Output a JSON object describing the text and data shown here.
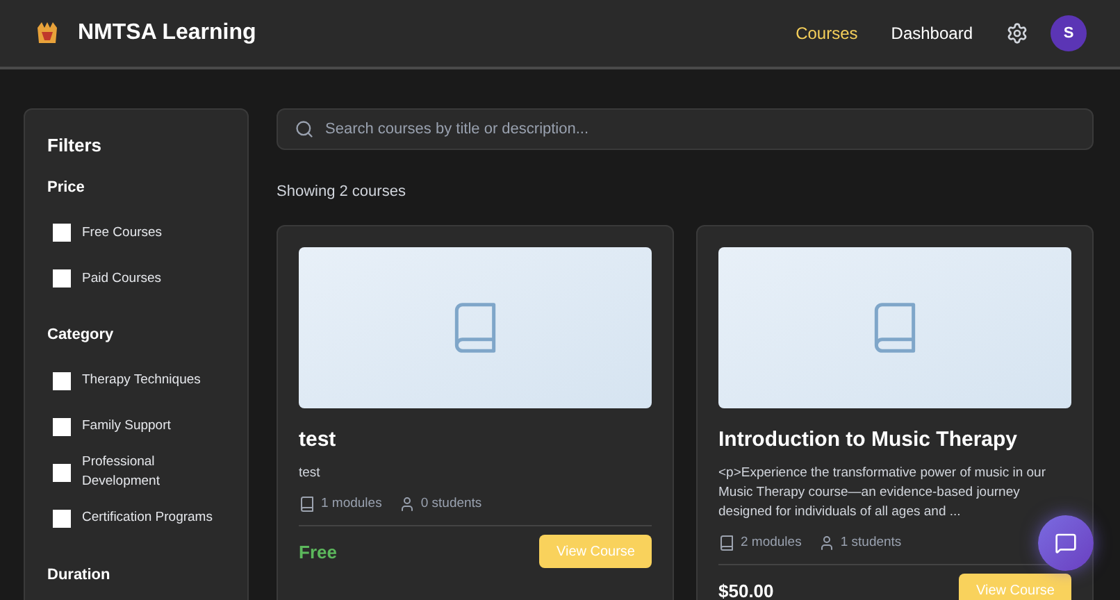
{
  "header": {
    "brand": "NMTSA Learning",
    "nav": [
      {
        "label": "Courses",
        "selected": true
      },
      {
        "label": "Dashboard",
        "selected": false
      }
    ],
    "avatar": "S"
  },
  "filters": {
    "title": "Filters",
    "groups": [
      {
        "title": "Price",
        "options": [
          {
            "label": "Free Courses",
            "checked": false
          },
          {
            "label": "Paid Courses",
            "checked": false
          }
        ]
      },
      {
        "title": "Category",
        "options": [
          {
            "label": "Therapy Techniques",
            "checked": false
          },
          {
            "label": "Family Support",
            "checked": false
          },
          {
            "label": "Professional Development",
            "checked": false
          },
          {
            "label": "Certification Programs",
            "checked": false
          }
        ]
      },
      {
        "title": "Duration"
      }
    ]
  },
  "search": {
    "placeholder": "Search courses by title or description..."
  },
  "result_count": "Showing 2 courses",
  "courses": [
    {
      "title": "test",
      "description": "test",
      "modules": "1 modules",
      "students": "0 students",
      "price": "Free",
      "free": true,
      "button": "View Course"
    },
    {
      "title": "Introduction to Music Therapy",
      "description": "<p>Experience the transformative power of music in our Music Therapy course—an evidence-based journey designed for individuals of all ages and ...",
      "modules": "2 modules",
      "students": "1 students",
      "price": "$50.00",
      "free": false,
      "button": "View Course"
    }
  ]
}
